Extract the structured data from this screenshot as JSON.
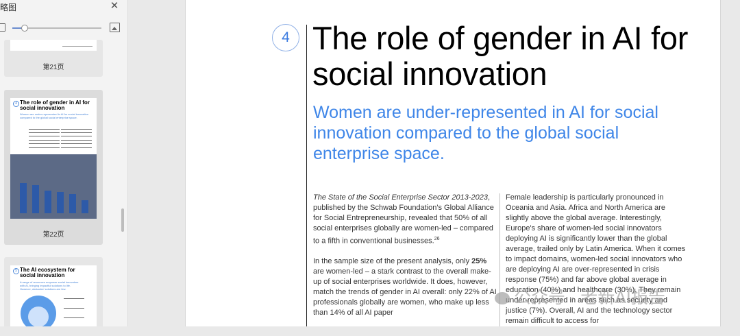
{
  "sidebar": {
    "title": "略图",
    "close_icon": "close-icon",
    "thumbnails": [
      {
        "label": "第21页"
      },
      {
        "label": "第22页",
        "mini_number": "4",
        "mini_heading": "The role of gender in AI for social innovation",
        "mini_sub": "Women are under-represented in AI for social innovation compared to the global social enterprise space.",
        "mini_bar_values": [
          0.74,
          0.68,
          0.55,
          0.52,
          0.47,
          0.32
        ]
      },
      {
        "label": "",
        "mini_number": "5",
        "mini_heading": "The AI ecosystem for social innovation",
        "mini_sub": "A range of resources empower social innovators with AI, bringing impactful solutions to life. However, obstacles' solutions are few."
      }
    ]
  },
  "page": {
    "section_number": "4",
    "heading": "The role of gender in AI for social innovation",
    "subheading": "Women are under-represented in AI for social innovation compared to the global social enterprise space.",
    "left_column": {
      "p1_title": "The State of the Social Enterprise Sector 2013-2023",
      "p1_rest": ", published by the Schwab Foundation's Global Alliance for Social Entrepreneurship, revealed that 50% of all social enterprises globally are women-led – compared to a fifth in conventional businesses.",
      "p1_sup": "26",
      "p2_intro": "In the sample size of the present analysis, only ",
      "p2_bold": "25%",
      "p2_rest": " are women-led – a stark contrast to the overall make-up of social enterprises worldwide. It does, however, match the trends of gender in AI overall: only 22% of AI professionals globally are women, who make up less than 14% of all AI paper"
    },
    "right_column": {
      "text": "Female leadership is particularly pronounced in Oceania and Asia. Africa and North America are slightly above the global average. Interestingly, Europe's share of women-led social innovators deploying AI is significantly lower than the global average, trailed only by Latin America. When it comes to impact domains, women-led social innovators who are deploying AI are over-represented in crisis response (75%) and far above global average in education (40%) and healthcare (30%). They remain under-represented in areas such as security and justice (7%). Overall, AI and the technology sector remain difficult to access for"
    }
  },
  "watermark": {
    "text": "公众号 · 老新AI报告"
  }
}
